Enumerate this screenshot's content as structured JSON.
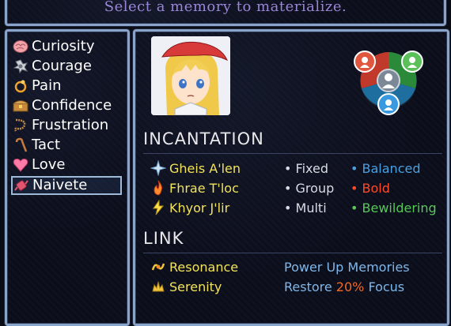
{
  "header": {
    "prompt": "Select a memory to materialize."
  },
  "memories": [
    {
      "label": "Curiosity",
      "icon": "brain-icon",
      "color": "#f2a3a8"
    },
    {
      "label": "Courage",
      "icon": "swirl-icon",
      "color": "#cfd3da"
    },
    {
      "label": "Pain",
      "icon": "ring-icon",
      "color": "#f0a22a"
    },
    {
      "label": "Confidence",
      "icon": "chest-icon",
      "color": "#c68a3a"
    },
    {
      "label": "Frustration",
      "icon": "rope-icon",
      "color": "#c38b4b"
    },
    {
      "label": "Tact",
      "icon": "cane-icon",
      "color": "#c47b3f"
    },
    {
      "label": "Love",
      "icon": "heart-icon",
      "color": "#ff7aa6"
    },
    {
      "label": "Naivete",
      "icon": "candy-icon",
      "color": "#e05570"
    }
  ],
  "selected_memory": "Naivete",
  "incantation": {
    "title": "INCANTATION",
    "rows": [
      {
        "name": "Gheis A'len",
        "icon": "ice-crystal-icon",
        "target": "• Fixed",
        "style": "• Balanced",
        "style_color": "#4aa0e0"
      },
      {
        "name": "Fhrae T'loc",
        "icon": "fire-icon",
        "target": "• Group",
        "style": "• Bold",
        "style_color": "#ff4a2a"
      },
      {
        "name": "Khyor J'lir",
        "icon": "lightning-icon",
        "target": "• Multi",
        "style": "• Bewildering",
        "style_color": "#58c85a"
      }
    ]
  },
  "link": {
    "title": "LINK",
    "rows": [
      {
        "name": "Resonance",
        "icon": "resonance-icon",
        "desc_before": "Power Up Memories",
        "highlight": "",
        "desc_after": ""
      },
      {
        "name": "Serenity",
        "icon": "serenity-icon",
        "desc_before": "Restore ",
        "highlight": "20%",
        "desc_after": " Focus"
      }
    ],
    "highlight_color": "#f06a2a"
  }
}
